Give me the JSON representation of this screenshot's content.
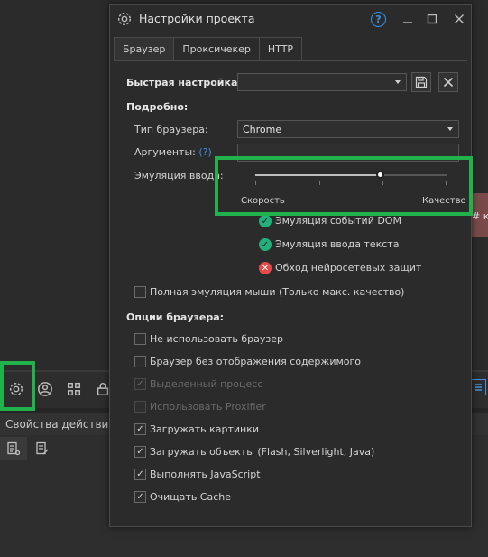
{
  "background": {
    "panel_title": "Свойства действия",
    "side_text": "# к"
  },
  "dialog": {
    "title": "Настройки проекта",
    "help_symbol": "?",
    "tabs": [
      {
        "label": "Браузер",
        "active": true
      },
      {
        "label": "Проксичекер",
        "active": false
      },
      {
        "label": "HTTP",
        "active": false
      }
    ],
    "quick_setup": {
      "label": "Быстрая настройка:",
      "value": ""
    },
    "details_heading": "Подробно:",
    "browser_type": {
      "label": "Тип браузера:",
      "value": "Chrome"
    },
    "arguments": {
      "label": "Аргументы:",
      "help": "(?)",
      "value": ""
    },
    "input_emulation": {
      "label": "Эмуляция ввода:",
      "left_label": "Скорость",
      "right_label": "Качество",
      "level_fraction": 0.66
    },
    "features": [
      {
        "label": "Эмуляция событий DOM",
        "status": "ok"
      },
      {
        "label": "Эмуляция ввода текста",
        "status": "ok"
      },
      {
        "label": "Обход нейросетевых защит",
        "status": "bad"
      }
    ],
    "full_mouse": {
      "label": "Полная эмуляция мыши (Только макс. качество)",
      "checked": false
    },
    "options_heading": "Опции браузера:",
    "options": [
      {
        "label": "Не использовать браузер",
        "checked": false,
        "disabled": false
      },
      {
        "label": "Браузер без отображения содержимого",
        "checked": false,
        "disabled": false
      },
      {
        "label": "Выделенный процесс",
        "checked": true,
        "disabled": true
      },
      {
        "label": "Использовать Proxifier",
        "checked": false,
        "disabled": true
      },
      {
        "label": "Загружать картинки",
        "checked": true,
        "disabled": false
      },
      {
        "label": "Загружать объекты (Flash, Silverlight, Java)",
        "checked": true,
        "disabled": false
      },
      {
        "label": "Выполнять JavaScript",
        "checked": true,
        "disabled": false
      },
      {
        "label": "Очищать Cache",
        "checked": true,
        "disabled": false
      }
    ]
  },
  "colors": {
    "highlight": "#21b24c",
    "accent": "#3b8fe6",
    "ok": "#22b07c",
    "bad": "#e44a4a"
  }
}
